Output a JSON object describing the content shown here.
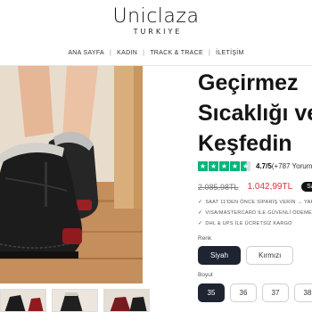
{
  "header": {
    "logo_main": "Uniclaza",
    "logo_sub": "TURKIYE"
  },
  "nav": {
    "items": [
      {
        "label": "ANA SAYFA"
      },
      {
        "label": "KADIN"
      },
      {
        "label": "TRACK & TRACE"
      },
      {
        "label": "İLETİŞİM"
      }
    ]
  },
  "product": {
    "title_lines": [
      "Geçirmez",
      "Sıcaklığı ve",
      "Keşfedin"
    ],
    "rating": {
      "score": "4.7/5",
      "count": "(+787 Yorum)",
      "stars_full": 4,
      "star_glyph": "★"
    },
    "old_price": "2.085,98TL",
    "new_price": "1.042,99TL",
    "sale_badge": "Sale",
    "features": [
      "SAAT 11'DEN ÖNCE SİPARİŞ VERİN → YARIN",
      "VISA/MASTERCARD İLE GÜVENLİ ÖDEME",
      "DHL & UPS İLE ÜCRETSİZ KARGO"
    ],
    "check_glyph": "✓",
    "color_label": "Renk",
    "colors": [
      {
        "label": "Siyah",
        "selected": true
      },
      {
        "label": "Kırmızı",
        "selected": false
      }
    ],
    "size_label": "Boyut",
    "sizes": [
      {
        "label": "35",
        "selected": true
      },
      {
        "label": "36",
        "selected": false
      },
      {
        "label": "37",
        "selected": false
      },
      {
        "label": "38",
        "selected": false
      }
    ]
  },
  "colors": {
    "trustpilot_green": "#00b67a",
    "sale_red": "#e0323c",
    "selected_dark": "#1f2433",
    "boot_black": "#1c1c1c",
    "wood": "#c9a078"
  },
  "icons": {
    "rating": "star-icon",
    "feature": "check-icon"
  }
}
